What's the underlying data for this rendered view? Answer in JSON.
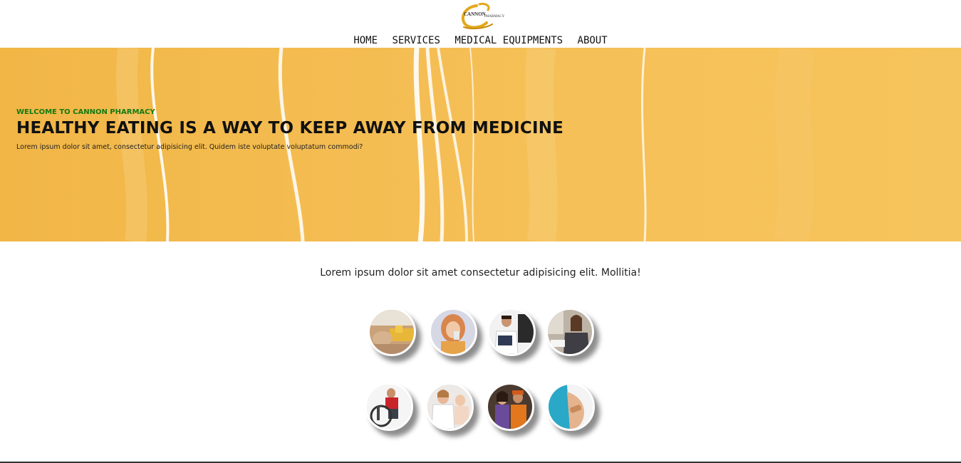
{
  "brand": {
    "logo_word1": "CANNON",
    "logo_word2": "PHARMACY",
    "logo_color": "#e2a91a"
  },
  "nav": {
    "items": [
      {
        "label": "HOME"
      },
      {
        "label": "SERVICES"
      },
      {
        "label": "MEDICAL EQUIPMENTS"
      },
      {
        "label": "ABOUT"
      }
    ]
  },
  "hero": {
    "eyebrow": "WELCOME TO CANNON PHARMACY",
    "title": "HEALTHY EATING IS A WAY TO KEEP AWAY FROM MEDICINE",
    "subtitle": "Lorem ipsum dolor sit amet, consectetur adipisicing elit. Quidem iste voluptate voluptatum commodi?",
    "background_color": "#f4bd52",
    "eyebrow_color": "#117a11"
  },
  "intro": {
    "text": "Lorem ipsum dolor sit amet consectetur adipisicing elit. Mollitia!"
  },
  "gallery": {
    "items": [
      {
        "icon": "pharmacy-counter-photo"
      },
      {
        "icon": "woman-drinking-photo"
      },
      {
        "icon": "pharmacist-reading-photo"
      },
      {
        "icon": "pharmacy-staff-photo"
      },
      {
        "icon": "wheelchair-photo"
      },
      {
        "icon": "nurse-patient-photo"
      },
      {
        "icon": "customers-photo"
      },
      {
        "icon": "bandaged-arm-photo"
      }
    ]
  }
}
